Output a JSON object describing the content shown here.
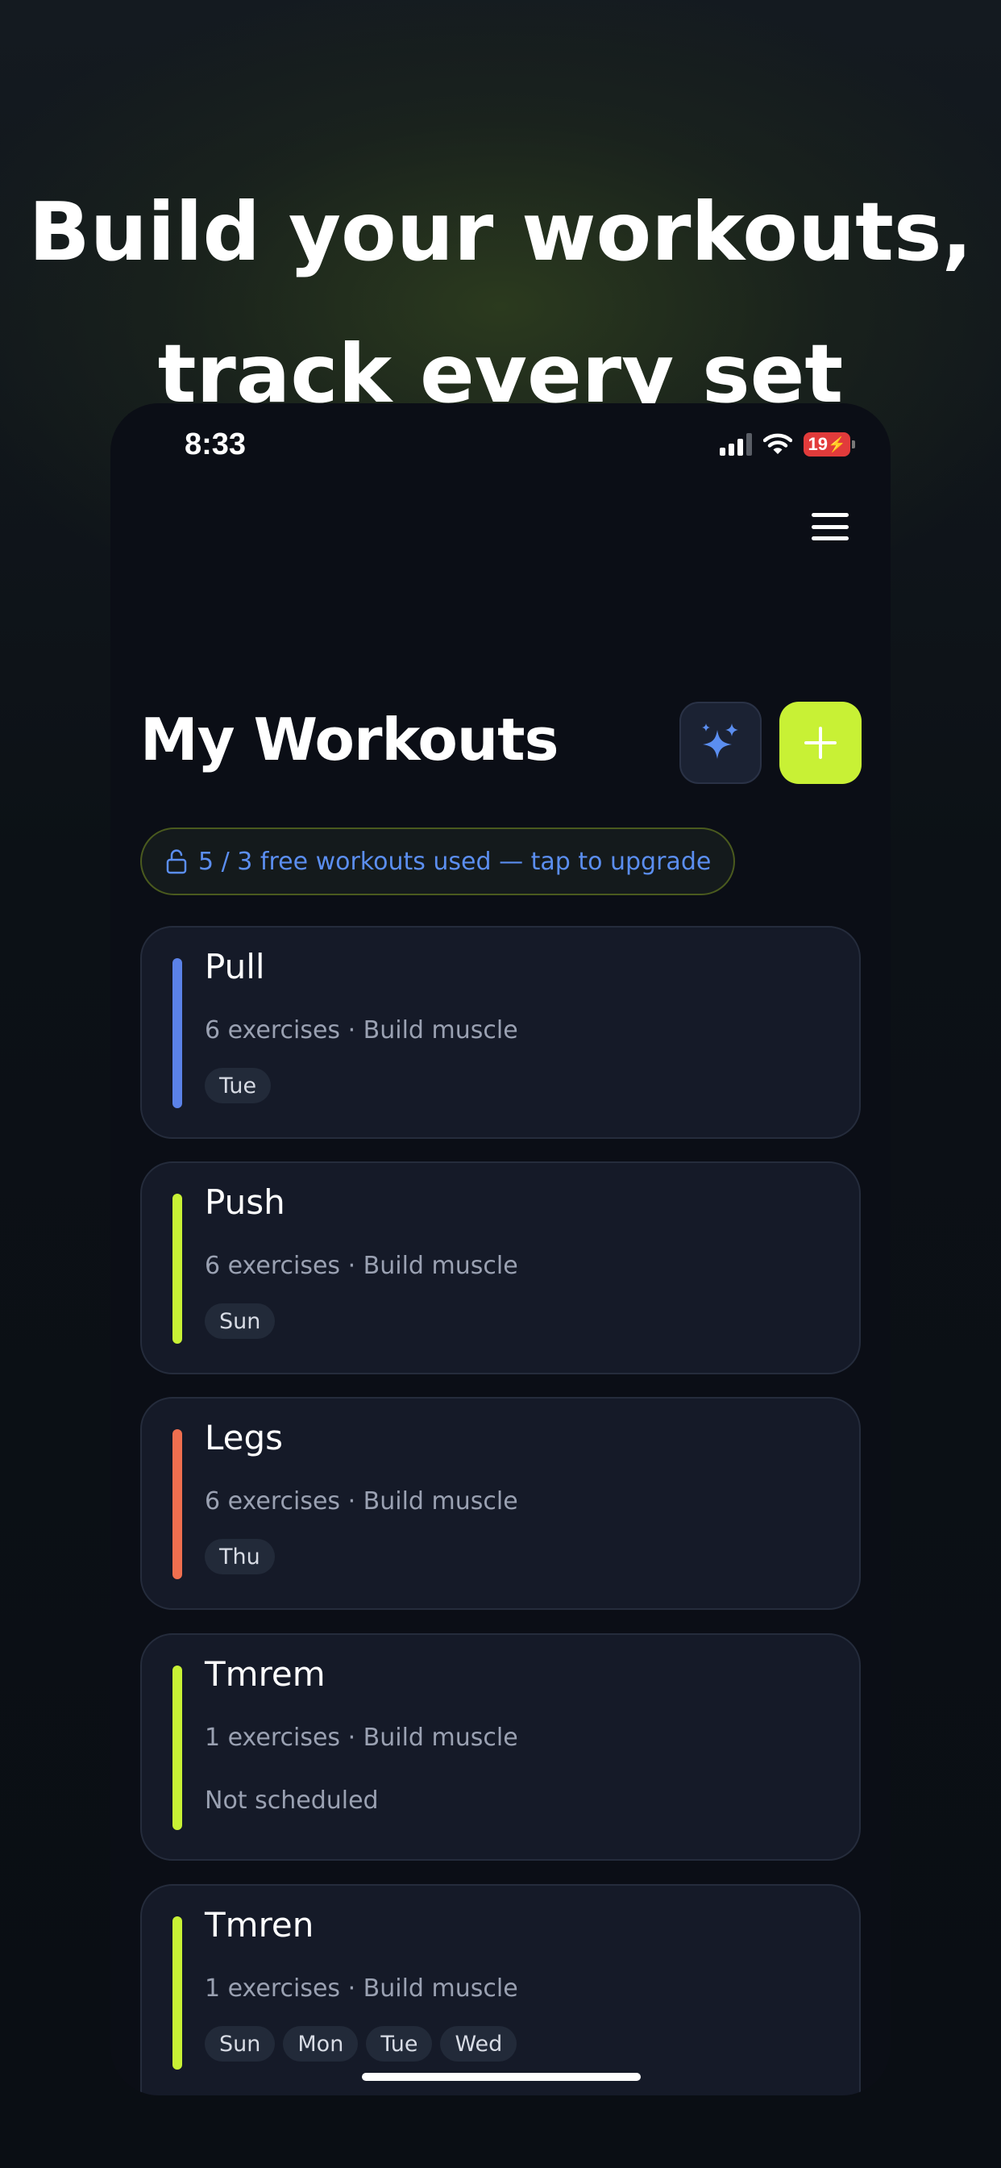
{
  "headline": {
    "line1": "Build your workouts,",
    "line2": "track every set"
  },
  "status_bar": {
    "time": "8:33",
    "battery": "19"
  },
  "header": {
    "title": "My Workouts",
    "ai_button_icon": "sparkles-icon",
    "add_button_icon": "plus-icon",
    "menu_icon": "hamburger-menu-icon"
  },
  "upgrade_banner": {
    "icon": "unlock-icon",
    "text": "5 / 3 free workouts used — tap to upgrade"
  },
  "workouts": [
    {
      "name": "Pull",
      "meta": "6 exercises · Build muscle",
      "days": [
        "Tue"
      ],
      "accent": "#5b82e8"
    },
    {
      "name": "Push",
      "meta": "6 exercises · Build muscle",
      "days": [
        "Sun"
      ],
      "accent": "#c8f135"
    },
    {
      "name": "Legs",
      "meta": "6 exercises · Build muscle",
      "days": [
        "Thu"
      ],
      "accent": "#ef6f4f"
    },
    {
      "name": "Tmrem",
      "meta": "1 exercises · Build muscle",
      "schedule": "Not scheduled",
      "accent": "#c8f135"
    },
    {
      "name": "Tmren",
      "meta": "1 exercises · Build muscle",
      "days": [
        "Sun",
        "Mon",
        "Tue",
        "Wed"
      ],
      "accent": "#c8f135"
    }
  ],
  "colors": {
    "accent_lime": "#c8f135",
    "link_blue": "#5b8ef0",
    "card_bg": "#151a28",
    "screen_bg": "#0b0e16"
  }
}
